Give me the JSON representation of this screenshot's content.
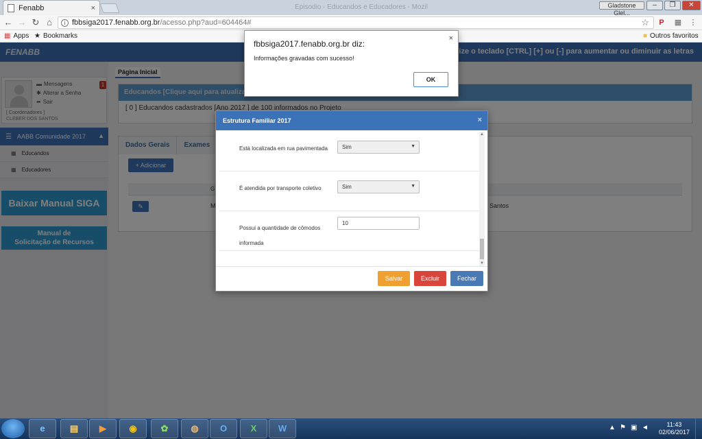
{
  "browser": {
    "tab_title": "Fenabb",
    "tab_close": "×",
    "window_title": "Episodio - Educandos e Educadores - Mozil",
    "user_chip": "Gladstone Glel...",
    "url_host": "fbbsiga2017.fenabb.org.br",
    "url_path": "/acesso.php?aud=604464#",
    "bookmarks": {
      "apps": "Apps",
      "bookmarks": "Bookmarks",
      "other": "Outros favoritos"
    }
  },
  "header": {
    "logo": "FENABB",
    "accessibility": "sibilidade: utilize o teclado [CTRL] [+] ou [-] para aumentar ou diminuir as letras"
  },
  "sidebar": {
    "messages": "Mensagens",
    "change_password": "Alterar a Senha",
    "logout": "Sair",
    "badge": "1",
    "role": "[ Coordenadores ]",
    "username": "CLEBER DOS SANTOS",
    "menu_title": "AABB Comunidade 2017",
    "items": [
      {
        "label": "Educandos"
      },
      {
        "label": "Educadores"
      }
    ],
    "manual_button": "Baixar Manual SIGA",
    "request_manual_line1": "Manual de",
    "request_manual_line2": "Solicitação de Recursos"
  },
  "content": {
    "breadcrumb": "Página Inicial",
    "panel_title": "Educandos [Clique aqui para atualizar a lista de alunos]",
    "panel_text": "[ 0 ] Educandos cadastrados [Ano 2017 ] de 100 informados no Projeto",
    "tabs": [
      "Dados Gerais",
      "Exames"
    ],
    "add_button": "+ Adicionar",
    "table_header": "G",
    "row_text_left": "M",
    "row_text_right": "s Santos"
  },
  "modal": {
    "title": "Estrutura Familiar 2017",
    "fields": [
      {
        "label": "Está localizada em rua pavimentada",
        "value": "Sim"
      },
      {
        "label": "É atendida por transporte coletivo",
        "value": "Sim"
      },
      {
        "label": "Possui a quantidade de cômodos informada",
        "value": "10"
      }
    ],
    "buttons": {
      "save": "Salvar",
      "delete": "Excluir",
      "close": "Fechar"
    },
    "colors": {
      "save": "#f0a030",
      "delete": "#d9453b",
      "close": "#4a7ab5"
    }
  },
  "alert": {
    "title": "fbbsiga2017.fenabb.org.br diz:",
    "message": "Informações gravadas com sucesso!",
    "ok_label": "OK"
  },
  "taskbar": {
    "time": "11:43",
    "date": "02/06/2017",
    "apps": [
      "ie-icon",
      "explorer-icon",
      "media-player-icon",
      "chrome-icon",
      "picasa-icon",
      "app-icon",
      "outlook-icon",
      "excel-icon",
      "word-icon"
    ]
  }
}
